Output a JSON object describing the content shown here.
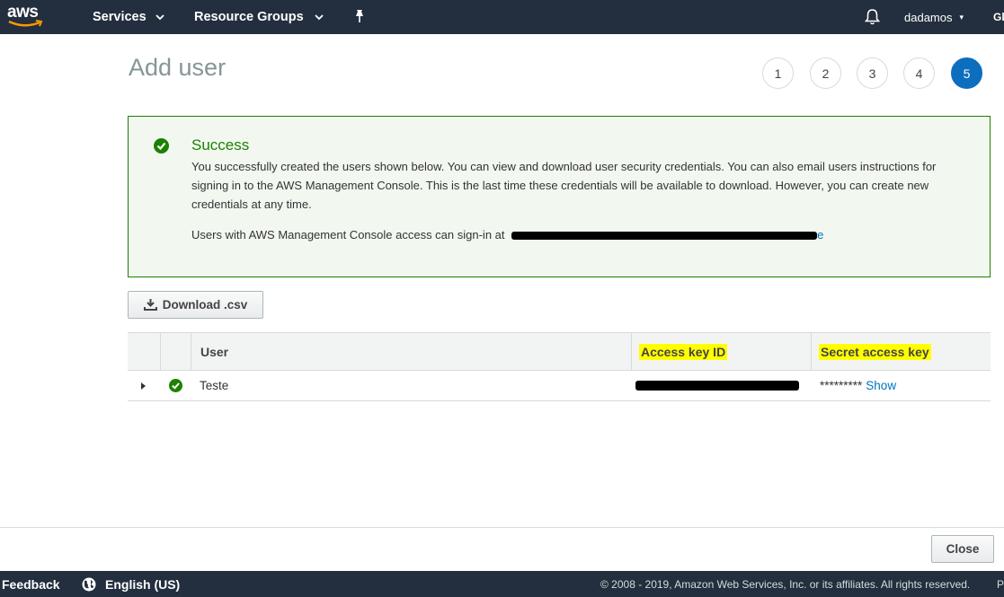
{
  "topnav": {
    "logo_text": "aws",
    "services_label": "Services",
    "resource_groups_label": "Resource Groups",
    "username": "dadamos",
    "region_stub": "Gl"
  },
  "page": {
    "title": "Add user",
    "steps": [
      "1",
      "2",
      "3",
      "4",
      "5"
    ],
    "active_step": "5"
  },
  "success": {
    "title": "Success",
    "description": "You successfully created the users shown below. You can view and download user security credentials. You can also email users instructions for signing in to the AWS Management Console. This is the last time these credentials will be available to download. However, you can create new credentials at any time.",
    "signin_prefix": "Users with AWS Management Console access can sign-in at",
    "signin_link_tail": "e"
  },
  "download_button": "Download .csv",
  "table": {
    "headers": {
      "user": "User",
      "access_key_id": "Access key ID",
      "secret_access_key": "Secret access key"
    },
    "rows": [
      {
        "user": "Teste",
        "secret_masked": "*********",
        "show_label": "Show"
      }
    ]
  },
  "close_button": "Close",
  "footer": {
    "feedback": "Feedback",
    "language": "English (US)",
    "copyright": "© 2008 - 2019, Amazon Web Services, Inc. or its affiliates. All rights reserved.",
    "privacy_stub": "P"
  },
  "colors": {
    "nav_bg": "#232f3e",
    "success_green": "#1d8102",
    "link_blue": "#0073bb",
    "active_step": "#0d6ebf",
    "highlight": "#ffff00"
  }
}
